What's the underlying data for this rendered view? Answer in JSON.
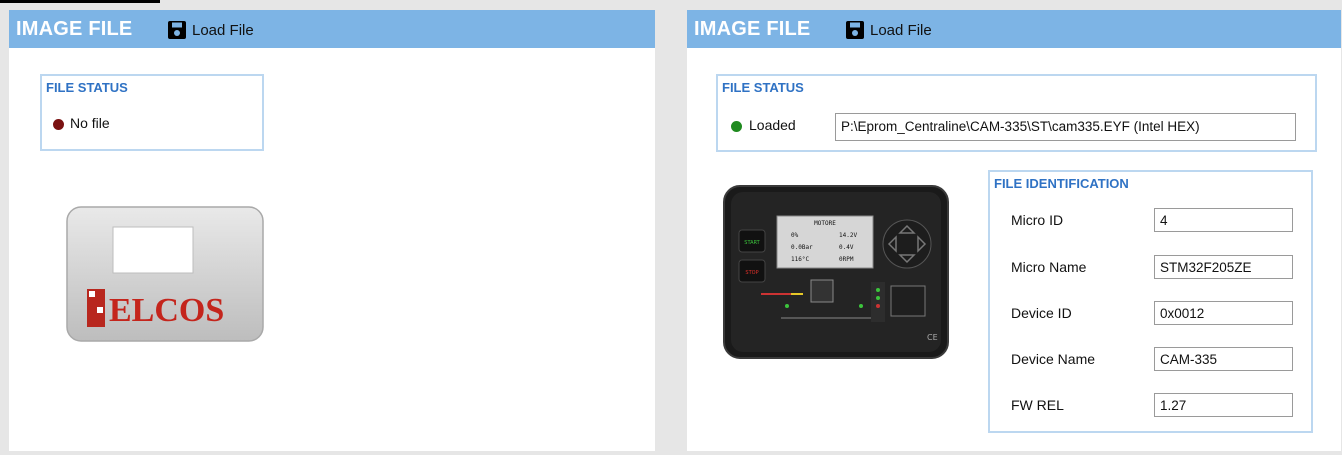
{
  "left_panel": {
    "header": {
      "title": "IMAGE FILE",
      "load_label": "Load File"
    },
    "file_status": {
      "title": "FILE STATUS",
      "status": "No file",
      "led_color": "#7a1111"
    },
    "device_image": {
      "brand_text": "ELCOS"
    }
  },
  "right_panel": {
    "header": {
      "title": "IMAGE FILE",
      "load_label": "Load File"
    },
    "file_status": {
      "title": "FILE STATUS",
      "status": "Loaded",
      "led_color": "#1f8a1f",
      "path": "P:\\Eprom_Centraline\\CAM-335\\ST\\cam335.EYF (Intel HEX)"
    },
    "device_image": {
      "screen_title": "MOTORE",
      "screen_values": [
        "0%",
        "14.2V",
        "0.0Bar",
        "0.4V",
        "116°C",
        "0RPM"
      ],
      "start_label": "START",
      "stop_label": "STOP"
    },
    "file_identification": {
      "title": "FILE IDENTIFICATION",
      "fields": [
        {
          "label": "Micro ID",
          "value": "4"
        },
        {
          "label": "Micro Name",
          "value": "STM32F205ZE"
        },
        {
          "label": "Device ID",
          "value": "0x0012"
        },
        {
          "label": "Device Name",
          "value": "CAM-335"
        },
        {
          "label": "FW REL",
          "value": "1.27"
        }
      ]
    }
  },
  "colors": {
    "header_bg": "#7db4e5",
    "group_border": "#bcd7f0",
    "group_title": "#2f72c4"
  }
}
